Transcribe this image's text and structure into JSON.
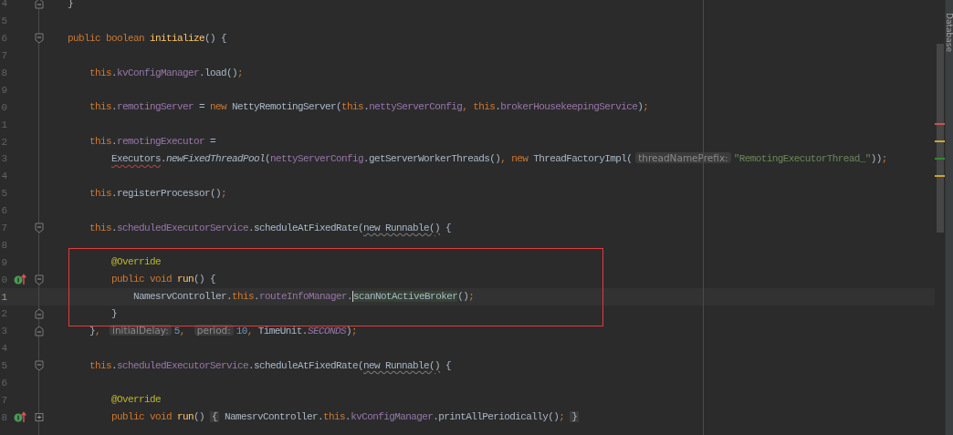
{
  "editor": {
    "lines": [
      {
        "number": "4",
        "current": false,
        "fold_marker": {
          "kind": "end"
        },
        "tokens": [
          {
            "kind": "plain",
            "text": "}"
          }
        ]
      },
      {
        "number": "5",
        "current": false
      },
      {
        "number": "6",
        "current": false,
        "fold_marker": {
          "kind": "start"
        },
        "tokens": [
          {
            "kind": "keyword",
            "text": "public boolean "
          },
          {
            "kind": "declaration",
            "text": "initialize"
          },
          {
            "kind": "plain",
            "text": "() {"
          }
        ],
        "children": [
          {
            "number": "7",
            "current": false
          },
          {
            "number": "8",
            "current": false,
            "tokens": [
              {
                "kind": "keyword",
                "text": "this"
              },
              {
                "kind": "plain",
                "text": "."
              },
              {
                "kind": "field",
                "text": "kvConfigManager"
              },
              {
                "kind": "plain",
                "text": ".load()"
              },
              {
                "kind": "keyword",
                "text": ";"
              }
            ]
          },
          {
            "number": "9",
            "current": false
          },
          {
            "number": "0",
            "current": false,
            "tokens": [
              {
                "kind": "keyword",
                "text": "this"
              },
              {
                "kind": "plain",
                "text": "."
              },
              {
                "kind": "field",
                "text": "remotingServer"
              },
              {
                "kind": "plain",
                "text": " = "
              },
              {
                "kind": "keyword",
                "text": "new "
              },
              {
                "kind": "plain",
                "text": "NettyRemotingServer("
              },
              {
                "kind": "keyword",
                "text": "this"
              },
              {
                "kind": "plain",
                "text": "."
              },
              {
                "kind": "field",
                "text": "nettyServerConfig"
              },
              {
                "kind": "keyword",
                "text": ", this"
              },
              {
                "kind": "plain",
                "text": "."
              },
              {
                "kind": "field",
                "text": "brokerHousekeepingService"
              },
              {
                "kind": "plain",
                "text": ")"
              },
              {
                "kind": "keyword",
                "text": ";"
              }
            ]
          },
          {
            "number": "1",
            "current": false
          },
          {
            "number": "2",
            "current": false,
            "tokens": [
              {
                "kind": "keyword",
                "text": "this"
              },
              {
                "kind": "plain",
                "text": "."
              },
              {
                "kind": "field",
                "text": "remotingExecutor"
              },
              {
                "kind": "plain",
                "text": " ="
              }
            ],
            "children": [
              {
                "number": "3",
                "current": false,
                "tokens": [
                  {
                    "kind": "error",
                    "text": "Executors"
                  },
                  {
                    "kind": "plain",
                    "text": "."
                  },
                  {
                    "kind": "static-method",
                    "text": "newFixedThreadPool"
                  },
                  {
                    "kind": "plain",
                    "text": "("
                  },
                  {
                    "kind": "field",
                    "text": "nettyServerConfig"
                  },
                  {
                    "kind": "plain",
                    "text": ".getServerWorkerThreads()"
                  },
                  {
                    "kind": "keyword",
                    "text": ", new "
                  },
                  {
                    "kind": "plain",
                    "text": "ThreadFactoryImpl("
                  },
                  {
                    "kind": "hint",
                    "text": "threadNamePrefix:"
                  },
                  {
                    "kind": "string",
                    "text": "\"RemotingExecutorThread_\""
                  },
                  {
                    "kind": "plain",
                    "text": "))"
                  },
                  {
                    "kind": "keyword",
                    "text": ";"
                  }
                ]
              }
            ]
          },
          {
            "number": "4",
            "current": false
          },
          {
            "number": "5",
            "current": false,
            "tokens": [
              {
                "kind": "keyword",
                "text": "this"
              },
              {
                "kind": "plain",
                "text": ".registerProcessor()"
              },
              {
                "kind": "keyword",
                "text": ";"
              }
            ]
          },
          {
            "number": "6",
            "current": false
          },
          {
            "number": "7",
            "current": false,
            "fold_marker": {
              "kind": "start"
            },
            "tokens": [
              {
                "kind": "keyword",
                "text": "this"
              },
              {
                "kind": "plain",
                "text": "."
              },
              {
                "kind": "field",
                "text": "scheduledExecutorService"
              },
              {
                "kind": "plain",
                "text": ".scheduleAtFixedRate("
              },
              {
                "kind": "warning",
                "text": "new Runnable()"
              },
              {
                "kind": "plain",
                "text": " {"
              }
            ],
            "children": [
              {
                "number": "8",
                "current": false
              },
              {
                "number": "9",
                "current": false,
                "tokens": [
                  {
                    "kind": "annotation",
                    "text": "@Override"
                  }
                ]
              },
              {
                "number": "0",
                "current": false,
                "fold_marker": {
                  "kind": "start"
                },
                "gutter_marker": {
                  "kind": "override"
                },
                "tokens": [
                  {
                    "kind": "keyword",
                    "text": "public void "
                  },
                  {
                    "kind": "declaration",
                    "text": "run"
                  },
                  {
                    "kind": "plain",
                    "text": "() {"
                  }
                ],
                "children": [
                  {
                    "number": "1",
                    "current": true,
                    "tokens": [
                      {
                        "kind": "plain",
                        "text": "NamesrvController."
                      },
                      {
                        "kind": "keyword",
                        "text": "this"
                      },
                      {
                        "kind": "plain",
                        "text": "."
                      },
                      {
                        "kind": "field",
                        "text": "routeInfoManager"
                      },
                      {
                        "kind": "plain",
                        "text": "."
                      },
                      {
                        "kind": "match",
                        "text": "scanNotActiveBroker",
                        "caret": true
                      },
                      {
                        "kind": "plain",
                        "text": "()"
                      },
                      {
                        "kind": "keyword",
                        "text": ";"
                      }
                    ]
                  }
                ]
              },
              {
                "number": "2",
                "current": false,
                "fold_marker": {
                  "kind": "end"
                },
                "tokens": [
                  {
                    "kind": "plain",
                    "text": "}"
                  }
                ]
              }
            ]
          },
          {
            "number": "3",
            "current": false,
            "fold_marker": {
              "kind": "end"
            },
            "tokens": [
              {
                "kind": "plain",
                "text": "}"
              },
              {
                "kind": "keyword",
                "text": ", "
              },
              {
                "kind": "hint",
                "text": "initialDelay:"
              },
              {
                "kind": "number",
                "text": "5"
              },
              {
                "kind": "keyword",
                "text": ", "
              },
              {
                "kind": "hint",
                "text": "period:"
              },
              {
                "kind": "number",
                "text": "10"
              },
              {
                "kind": "keyword",
                "text": ", "
              },
              {
                "kind": "plain",
                "text": "TimeUnit."
              },
              {
                "kind": "constant",
                "text": "SECONDS"
              },
              {
                "kind": "plain",
                "text": ")"
              },
              {
                "kind": "keyword",
                "text": ";"
              }
            ]
          },
          {
            "number": "4",
            "current": false
          },
          {
            "number": "5",
            "current": false,
            "fold_marker": {
              "kind": "start"
            },
            "tokens": [
              {
                "kind": "keyword",
                "text": "this"
              },
              {
                "kind": "plain",
                "text": "."
              },
              {
                "kind": "field",
                "text": "scheduledExecutorService"
              },
              {
                "kind": "plain",
                "text": ".scheduleAtFixedRate("
              },
              {
                "kind": "warning",
                "text": "new Runnable()"
              },
              {
                "kind": "plain",
                "text": " {"
              }
            ],
            "children": [
              {
                "number": "6",
                "current": false
              },
              {
                "number": "7",
                "current": false,
                "tokens": [
                  {
                    "kind": "annotation",
                    "text": "@Override"
                  }
                ]
              },
              {
                "number": "8",
                "current": false,
                "fold_marker": {
                  "kind": "collapsed"
                },
                "gutter_marker": {
                  "kind": "override"
                },
                "tokens": [
                  {
                    "kind": "keyword",
                    "text": "public void "
                  },
                  {
                    "kind": "declaration",
                    "text": "run"
                  },
                  {
                    "kind": "plain",
                    "text": "() "
                  },
                  {
                    "kind": "folded",
                    "text": "{"
                  },
                  {
                    "kind": "plain",
                    "text": " NamesrvController."
                  },
                  {
                    "kind": "keyword",
                    "text": "this"
                  },
                  {
                    "kind": "plain",
                    "text": "."
                  },
                  {
                    "kind": "field",
                    "text": "kvConfigManager"
                  },
                  {
                    "kind": "plain",
                    "text": ".printAllPeriodically()"
                  },
                  {
                    "kind": "keyword",
                    "text": "; "
                  },
                  {
                    "kind": "folded",
                    "text": "}"
                  }
                ]
              }
            ]
          }
        ]
      }
    ]
  },
  "error_stripe": [
    {
      "color": "#c75450"
    },
    {
      "color": "#d0a431"
    },
    {
      "color": "#2f8a2f"
    },
    {
      "color": "#d0a431"
    }
  ],
  "tool_window_strip": {
    "label": "Database"
  }
}
